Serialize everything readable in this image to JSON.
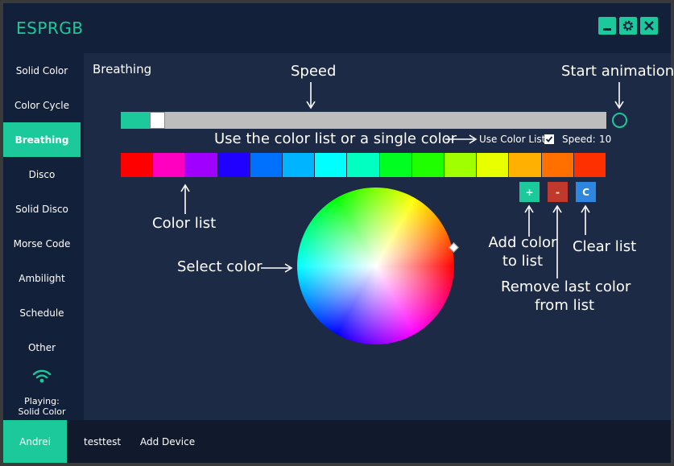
{
  "app": {
    "title": "ESPRGB"
  },
  "sidebar": {
    "items": [
      {
        "label": "Solid Color",
        "active": false
      },
      {
        "label": "Color Cycle",
        "active": false
      },
      {
        "label": "Breathing",
        "active": true
      },
      {
        "label": "Disco",
        "active": false
      },
      {
        "label": "Solid Disco",
        "active": false
      },
      {
        "label": "Morse Code",
        "active": false
      },
      {
        "label": "Ambilight",
        "active": false
      },
      {
        "label": "Schedule",
        "active": false
      },
      {
        "label": "Other",
        "active": false
      }
    ],
    "status_line1": "Playing:",
    "status_line2": "Solid Color"
  },
  "bottom": {
    "devices": [
      "Andrei",
      "testtest"
    ],
    "add_device_label": "Add Device"
  },
  "main": {
    "page_title": "Breathing",
    "speed_slider_value": 0.06,
    "use_color_list_label": "Use Color List",
    "use_color_list_checked": true,
    "speed_label": "Speed:",
    "speed_value": "10",
    "color_list": [
      "#ff0000",
      "#ff00c0",
      "#a000ff",
      "#2000ff",
      "#0070ff",
      "#00b4ff",
      "#00ffff",
      "#00ffc0",
      "#00ff20",
      "#20ff00",
      "#a0ff00",
      "#e8ff00",
      "#ffb000",
      "#ff7000",
      "#ff3000"
    ],
    "add_button_label": "+",
    "remove_button_label": "-",
    "clear_button_label": "C"
  },
  "annotations": {
    "speed": "Speed",
    "start_animation": "Start animation",
    "use_list": "Use the color list or a single color",
    "color_list": "Color list",
    "select_color": "Select color",
    "add_color_1": "Add color",
    "add_color_2": "to list",
    "clear_list": "Clear list",
    "remove_last_1": "Remove last color",
    "remove_last_2": "from list"
  },
  "colors": {
    "accent": "#1bc99a",
    "background": "#1c2a45",
    "sidebar": "#13203a",
    "add": "#1bc99a",
    "remove": "#c0392b",
    "clear": "#2e86de"
  }
}
